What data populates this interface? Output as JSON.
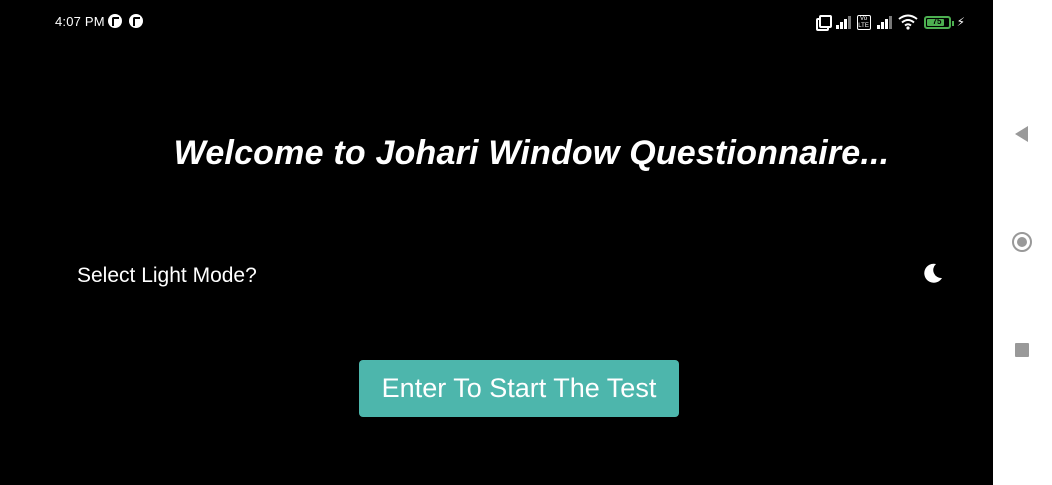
{
  "status_bar": {
    "time": "4:07 PM",
    "left_icons": [
      "notification-icon",
      "notification-icon"
    ],
    "volte_label": "Vo LTE",
    "battery_level": "75",
    "battery_color": "#4caf50"
  },
  "main": {
    "title": "Welcome to Johari Window Questionnaire...",
    "light_mode_label": "Select Light Mode?",
    "theme_toggle_icon": "moon-icon",
    "start_button_label": "Enter To Start The Test",
    "accent_color": "#4db6ac"
  },
  "nav_bar": {
    "buttons": [
      "back-icon",
      "home-icon",
      "recents-icon"
    ]
  }
}
